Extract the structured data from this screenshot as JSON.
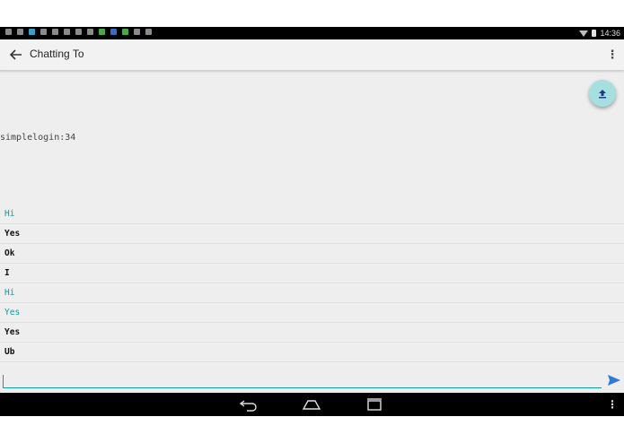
{
  "status_bar": {
    "time": "14:36",
    "icons": [
      "notification-icon",
      "settings-icon",
      "app-icon",
      "gallery-icon",
      "flipboard-icon",
      "video-icon",
      "link-icon",
      "sync-icon",
      "download-icon",
      "mail-icon",
      "android-icon",
      "usb-icon",
      "image-icon"
    ],
    "icon_colors": [
      "#8a8a8a",
      "#8a8a8a",
      "#3aa0c8",
      "#8a8a8a",
      "#8a8a8a",
      "#8a8a8a",
      "#8a8a8a",
      "#8a8a8a",
      "#4aa84a",
      "#3a6ac8",
      "#4aa84a",
      "#8a8a8a",
      "#8a8a8a"
    ]
  },
  "app_bar": {
    "back_icon": "back-arrow-icon",
    "title": "Chatting To",
    "overflow_label": "⋮"
  },
  "fab": {
    "icon": "upload-icon",
    "color": "#a6dfe0"
  },
  "contact_id": "simplelogin:34",
  "messages": [
    {
      "text": "Hi",
      "sender": "mine"
    },
    {
      "text": "Yes",
      "sender": "theirs"
    },
    {
      "text": "Ok",
      "sender": "theirs"
    },
    {
      "text": "I",
      "sender": "theirs"
    },
    {
      "text": "Hi",
      "sender": "mine"
    },
    {
      "text": "Yes",
      "sender": "mine"
    },
    {
      "text": "Yes",
      "sender": "theirs"
    },
    {
      "text": "Ub",
      "sender": "theirs"
    }
  ],
  "composer": {
    "value": "",
    "placeholder": ""
  },
  "colors": {
    "accent": "#0e9e9b",
    "own_message": "#0e9e9b",
    "other_message": "#111111"
  },
  "nav_bar": {
    "overflow_label": "⋮"
  }
}
